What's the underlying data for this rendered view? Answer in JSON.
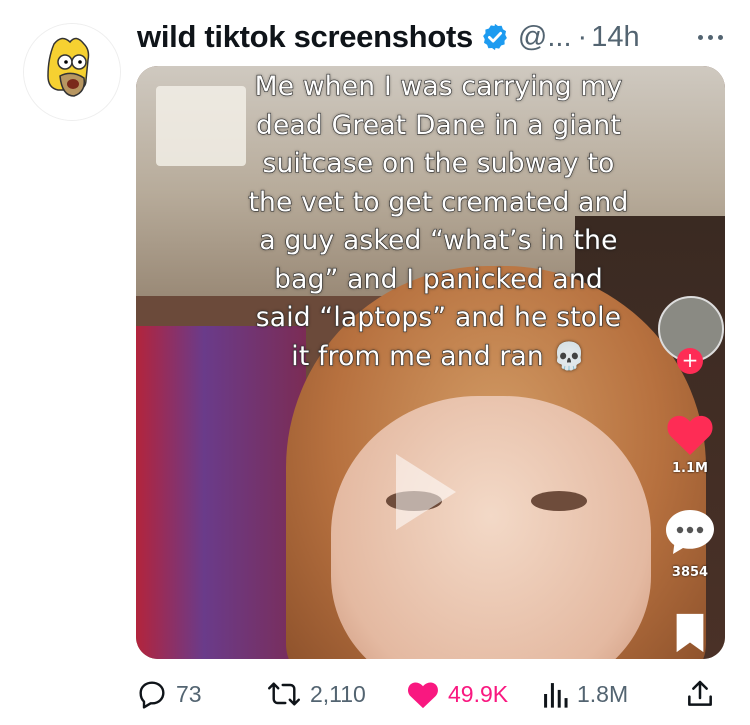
{
  "tweet": {
    "display_name": "wild tiktok screenshots",
    "handle": "@...",
    "separator": "·",
    "time": "14h"
  },
  "media": {
    "caption_lines": [
      "Me when I was carrying my",
      "dead Great Dane in a giant",
      "suitcase on the subway to",
      "the vet to get cremated and",
      "a guy asked “what’s in the",
      "bag” and I panicked and",
      "said “laptops” and he stole",
      "it from me and ran 💀"
    ],
    "likes": "1.1M",
    "comments": "3854"
  },
  "actions": {
    "replies": "73",
    "retweets": "2,110",
    "likes": "49.9K",
    "views": "1.8M"
  },
  "colors": {
    "verified": "#1d9bf0",
    "like": "#f91880",
    "muted": "#536471",
    "tiktok_red": "#fe2c55"
  },
  "icons": [
    "verified-badge-icon",
    "more-icon",
    "play-icon",
    "tiktok-plus-icon",
    "tiktok-heart-icon",
    "tiktok-comment-icon",
    "tiktok-bookmark-icon",
    "reply-icon",
    "retweet-icon",
    "like-icon",
    "views-icon",
    "share-icon"
  ]
}
